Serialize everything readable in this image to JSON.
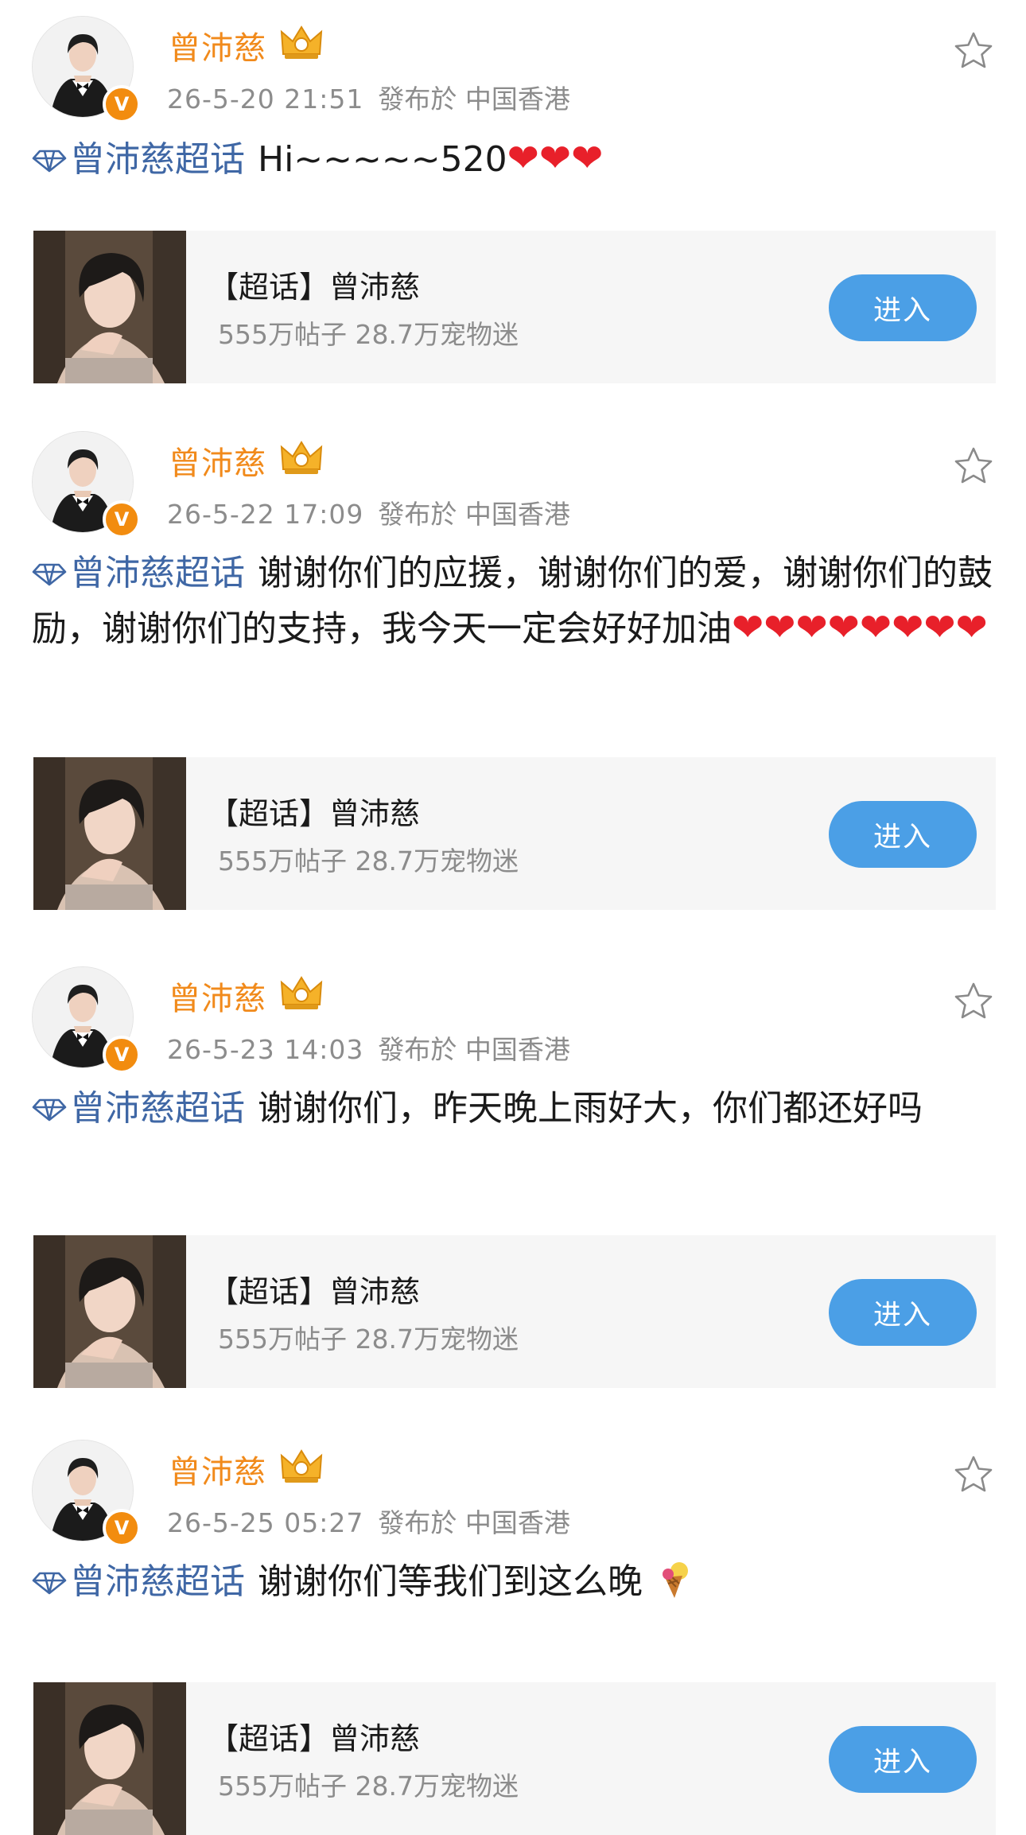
{
  "posts": [
    {
      "username": "曾沛慈",
      "time": "26-5-20 21:51",
      "location": "發布於 中国香港",
      "topic": "曾沛慈超话",
      "text": "Hi~~~~~520",
      "hearts": "❤❤❤",
      "text2": "",
      "card": {
        "title": "【超话】曾沛慈",
        "stats": "555万帖子 28.7万宠物迷",
        "button": "进入"
      }
    },
    {
      "username": "曾沛慈",
      "time": "26-5-22 17:09",
      "location": "發布於 中国香港",
      "topic": "曾沛慈超话",
      "text": "谢谢你们的应援，谢谢你们的爱，谢谢你们的鼓励，谢谢你们的支持，我今天一定会好好加油",
      "hearts": "❤❤❤❤❤❤❤❤",
      "text2": "",
      "card": {
        "title": "【超话】曾沛慈",
        "stats": "555万帖子 28.7万宠物迷",
        "button": "进入"
      }
    },
    {
      "username": "曾沛慈",
      "time": "26-5-23 14:03",
      "location": "發布於 中国香港",
      "topic": "曾沛慈超话",
      "text": "谢谢你们，昨天晚上雨好大，你们都还好吗",
      "hearts": "",
      "text2": "",
      "card": {
        "title": "【超话】曾沛慈",
        "stats": "555万帖子 28.7万宠物迷",
        "button": "进入"
      }
    },
    {
      "username": "曾沛慈",
      "time": "26-5-25 05:27",
      "location": "發布於 中国香港",
      "topic": "曾沛慈超话",
      "text": "谢谢你们等我们到这么晚",
      "hearts": "",
      "text2": "",
      "card": {
        "title": "【超话】曾沛慈",
        "stats": "555万帖子 28.7万宠物迷",
        "button": "进入"
      }
    }
  ],
  "icons": {
    "verified": "V",
    "vip_crown": "crown-icon",
    "favorite": "star-icon",
    "topic": "diamond-icon",
    "emoji_last": "icecream-icon"
  },
  "colors": {
    "username": "#f18a1b",
    "topic": "#3f67a5",
    "button": "#4b9fe6",
    "heart": "#e8202a",
    "card_bg": "#f6f6f6"
  }
}
